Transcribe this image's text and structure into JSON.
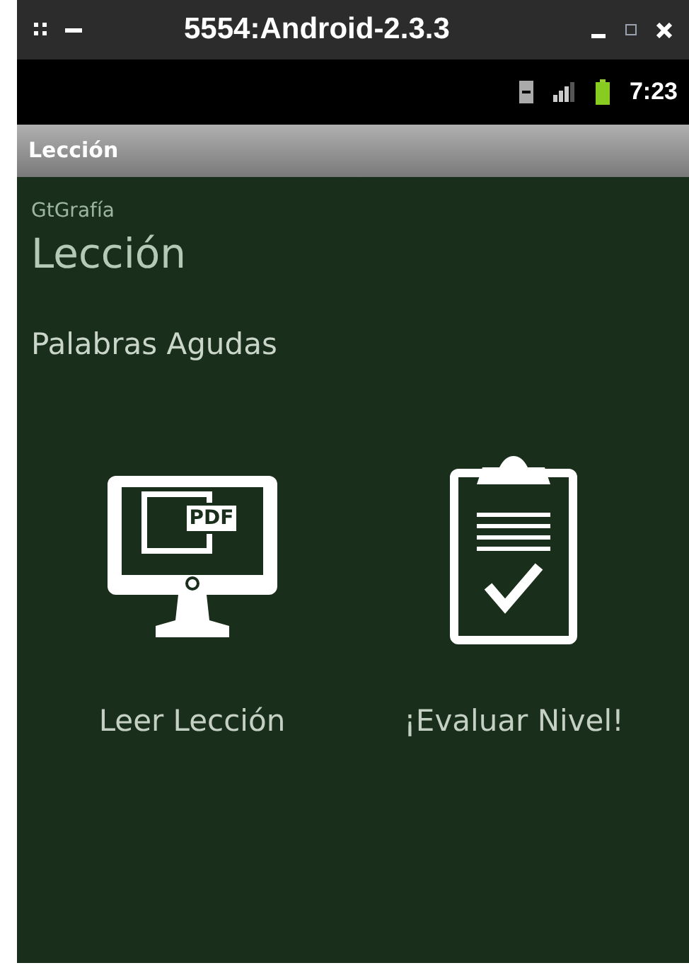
{
  "window": {
    "title": "5554:Android-2.3.3"
  },
  "status_bar": {
    "time": "7:23"
  },
  "action_bar": {
    "title": "Lección"
  },
  "content": {
    "app_name": "GtGrafía",
    "heading": "Lección",
    "topic": "Palabras Agudas",
    "actions": [
      {
        "kind": "read",
        "label": "Leer Lección",
        "icon_text": "PDF"
      },
      {
        "kind": "evaluate",
        "label": "¡Evaluar Nivel!"
      }
    ]
  }
}
